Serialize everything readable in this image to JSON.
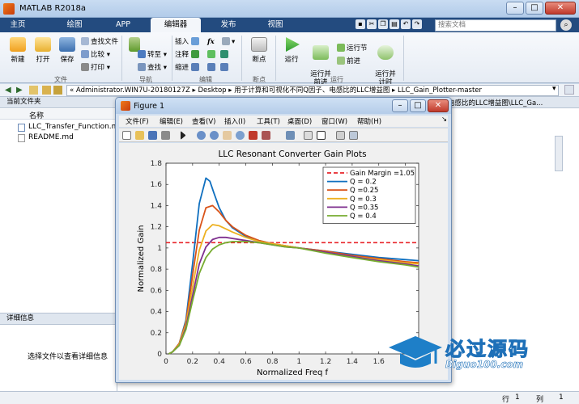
{
  "app": {
    "title": "MATLAB R2018a"
  },
  "tabs": [
    "主页",
    "绘图",
    "APP",
    "编辑器",
    "发布",
    "视图"
  ],
  "search": {
    "placeholder": "搜索文档"
  },
  "ribbon": {
    "new": "新建",
    "open": "打开",
    "save": "保存",
    "find_files": "查找文件",
    "compare": "比较",
    "print": "打印",
    "insert": "插入",
    "fx": "fx",
    "comment": "注释",
    "indent": "缩进",
    "goto": "转至",
    "find": "查找",
    "breakpoints": "断点",
    "run": "运行",
    "run_advance": "运行并\n前进",
    "run_section": "运行节",
    "advance": "前进",
    "run_time": "运行并\n计时",
    "groups": {
      "file": "文件",
      "nav": "导航",
      "edit": "编辑",
      "bp": "断点",
      "run": "运行"
    }
  },
  "address": {
    "path": "« Administrator.WIN7U-20180127Z  ▸  Desktop  ▸  用于计算和可视化不同Q因子、电感比的LLC增益图  ▸  LLC_Gain_Plotter-master"
  },
  "current_folder": {
    "title": "当前文件夹",
    "col_name": "名称",
    "files": [
      "LLC_Transfer_Function.m",
      "README.md"
    ]
  },
  "details": {
    "title": "详细信息",
    "hint": "选择文件以查看详细信息"
  },
  "background_path_fragment": "电感比的LLC增益图\\LLC_Ga...",
  "status": {
    "row_label": "行",
    "row_value": "1",
    "col_label": "列",
    "col_value": "1"
  },
  "figure": {
    "title": "Figure 1",
    "menu": [
      "文件(F)",
      "编辑(E)",
      "查看(V)",
      "插入(I)",
      "工具(T)",
      "桌面(D)",
      "窗口(W)",
      "帮助(H)"
    ]
  },
  "watermark": {
    "text": "必过源码",
    "url": "Biguo100.com"
  },
  "chart_data": {
    "type": "line",
    "title": "LLC Resonant Converter Gain Plots",
    "xlabel": "Normalized Freq f",
    "ylabel": "Normalized Gain",
    "xlim": [
      0,
      1.9
    ],
    "ylim": [
      0,
      1.8
    ],
    "xticks": [
      "0",
      "0.2",
      "0.4",
      "0.6",
      "0.8",
      "1",
      "1.2",
      "1.4",
      "1.6",
      "1.8"
    ],
    "yticks": [
      "0",
      "0.2",
      "0.4",
      "0.6",
      "0.8",
      "1",
      "1.2",
      "1.4",
      "1.6",
      "1.8"
    ],
    "legend_position": "top-right",
    "reference": {
      "name": "Gain Margin =1.05",
      "value": 1.05,
      "color": "#e8242a"
    },
    "series": [
      {
        "name": "Q = 0.2",
        "color": "#0f6fbf",
        "x": [
          0.02,
          0.05,
          0.1,
          0.15,
          0.2,
          0.25,
          0.3,
          0.33,
          0.36,
          0.4,
          0.45,
          0.5,
          0.6,
          0.7,
          0.8,
          0.9,
          1.0,
          1.2,
          1.4,
          1.6,
          1.8,
          1.9
        ],
        "y": [
          0.0,
          0.02,
          0.1,
          0.32,
          0.85,
          1.42,
          1.66,
          1.63,
          1.52,
          1.38,
          1.26,
          1.19,
          1.11,
          1.07,
          1.04,
          1.02,
          1.0,
          0.97,
          0.94,
          0.91,
          0.89,
          0.88
        ]
      },
      {
        "name": "Q =0.25",
        "color": "#d95319",
        "x": [
          0.02,
          0.05,
          0.1,
          0.15,
          0.2,
          0.25,
          0.3,
          0.35,
          0.4,
          0.45,
          0.5,
          0.6,
          0.7,
          0.8,
          0.9,
          1.0,
          1.2,
          1.4,
          1.6,
          1.8,
          1.9
        ],
        "y": [
          0.0,
          0.02,
          0.1,
          0.3,
          0.74,
          1.17,
          1.38,
          1.4,
          1.34,
          1.26,
          1.2,
          1.12,
          1.07,
          1.04,
          1.02,
          1.0,
          0.97,
          0.93,
          0.9,
          0.87,
          0.86
        ]
      },
      {
        "name": "Q = 0.3",
        "color": "#edb120",
        "x": [
          0.02,
          0.05,
          0.1,
          0.15,
          0.2,
          0.25,
          0.3,
          0.35,
          0.4,
          0.45,
          0.5,
          0.6,
          0.7,
          0.8,
          0.9,
          1.0,
          1.2,
          1.4,
          1.6,
          1.8,
          1.9
        ],
        "y": [
          0.0,
          0.02,
          0.09,
          0.28,
          0.63,
          0.98,
          1.16,
          1.22,
          1.21,
          1.18,
          1.15,
          1.1,
          1.06,
          1.04,
          1.02,
          1.0,
          0.96,
          0.92,
          0.89,
          0.86,
          0.85
        ]
      },
      {
        "name": "Q =0.35",
        "color": "#7e2f8e",
        "x": [
          0.02,
          0.05,
          0.1,
          0.15,
          0.2,
          0.25,
          0.3,
          0.35,
          0.4,
          0.45,
          0.5,
          0.6,
          0.7,
          0.8,
          0.9,
          1.0,
          1.2,
          1.4,
          1.6,
          1.8,
          1.9
        ],
        "y": [
          0.0,
          0.02,
          0.08,
          0.25,
          0.55,
          0.85,
          1.01,
          1.08,
          1.1,
          1.1,
          1.09,
          1.07,
          1.05,
          1.03,
          1.01,
          1.0,
          0.96,
          0.92,
          0.88,
          0.85,
          0.83
        ]
      },
      {
        "name": "Q = 0.4",
        "color": "#77ac30",
        "x": [
          0.02,
          0.05,
          0.1,
          0.15,
          0.2,
          0.25,
          0.3,
          0.35,
          0.4,
          0.45,
          0.5,
          0.6,
          0.7,
          0.8,
          0.9,
          1.0,
          1.2,
          1.4,
          1.6,
          1.8,
          1.9
        ],
        "y": [
          0.0,
          0.02,
          0.08,
          0.23,
          0.5,
          0.76,
          0.91,
          0.99,
          1.03,
          1.05,
          1.06,
          1.06,
          1.05,
          1.03,
          1.01,
          1.0,
          0.95,
          0.91,
          0.87,
          0.84,
          0.82
        ]
      }
    ]
  }
}
